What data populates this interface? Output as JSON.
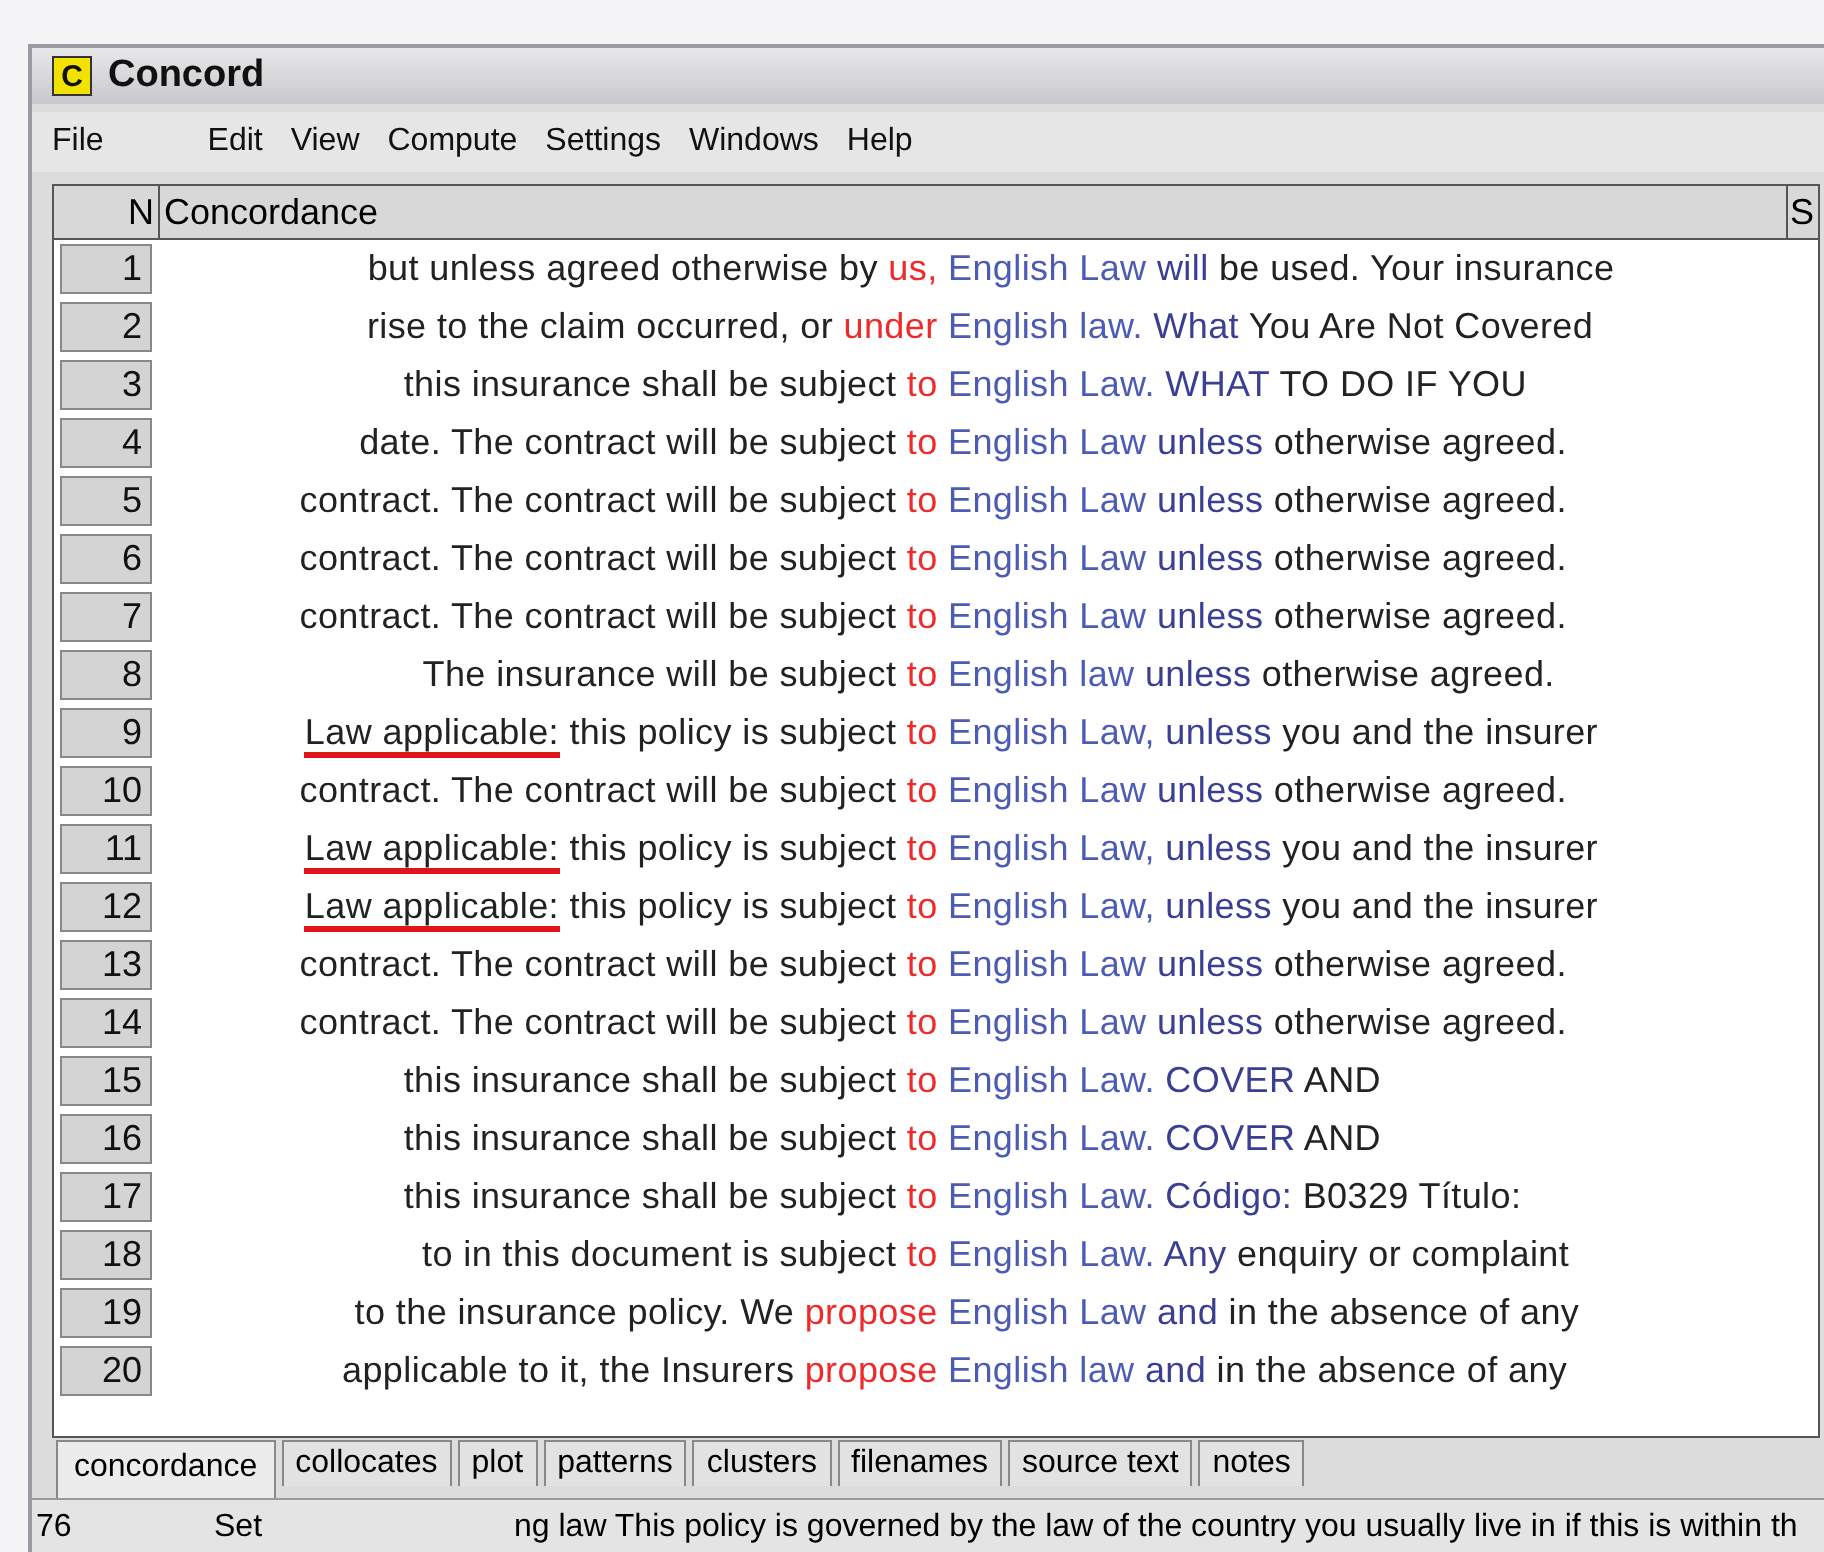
{
  "window": {
    "title": "Concord",
    "logo": "C"
  },
  "menu": [
    "File",
    "Edit",
    "View",
    "Compute",
    "Settings",
    "Windows",
    "Help"
  ],
  "table": {
    "columns": [
      "N",
      "Concordance",
      "S"
    ],
    "rows": [
      {
        "n": "1",
        "left": "but unless agreed otherwise by",
        "collocate": "us,",
        "node": "English Law",
        "right_collocate": "will",
        "right": "be used. Your insurance"
      },
      {
        "n": "2",
        "left": "rise to the claim occurred, or",
        "collocate": "under",
        "node": "English law.",
        "right_collocate": "What",
        "right": "You Are Not Covered"
      },
      {
        "n": "3",
        "left": "this insurance shall be subject",
        "collocate": "to",
        "node": "English Law.",
        "right_collocate": "WHAT",
        "right": "TO DO IF YOU"
      },
      {
        "n": "4",
        "left": "date. The contract will be subject",
        "collocate": "to",
        "node": "English Law",
        "right_collocate": "unless",
        "right": "otherwise agreed."
      },
      {
        "n": "5",
        "left": "contract. The contract will be subject",
        "collocate": "to",
        "node": "English Law",
        "right_collocate": "unless",
        "right": "otherwise agreed."
      },
      {
        "n": "6",
        "left": "contract. The contract will be subject",
        "collocate": "to",
        "node": "English Law",
        "right_collocate": "unless",
        "right": "otherwise agreed."
      },
      {
        "n": "7",
        "left": "contract. The contract will be subject",
        "collocate": "to",
        "node": "English Law",
        "right_collocate": "unless",
        "right": "otherwise agreed."
      },
      {
        "n": "8",
        "left": "The insurance will be subject",
        "collocate": "to",
        "node": "English law",
        "right_collocate": "unless",
        "right": "otherwise agreed."
      },
      {
        "n": "9",
        "marked": "Law applicable:",
        "left": "this policy is subject",
        "collocate": "to",
        "node": "English Law,",
        "right_collocate": "unless",
        "right": "you and the insurer"
      },
      {
        "n": "10",
        "left": "contract. The contract will be subject",
        "collocate": "to",
        "node": "English Law",
        "right_collocate": "unless",
        "right": "otherwise agreed."
      },
      {
        "n": "11",
        "marked": "Law applicable:",
        "left": "this policy is subject",
        "collocate": "to",
        "node": "English Law,",
        "right_collocate": "unless",
        "right": "you and the insurer"
      },
      {
        "n": "12",
        "marked": "Law applicable:",
        "left": "this policy is subject",
        "collocate": "to",
        "node": "English Law,",
        "right_collocate": "unless",
        "right": "you and the insurer"
      },
      {
        "n": "13",
        "left": "contract. The contract will be subject",
        "collocate": "to",
        "node": "English Law",
        "right_collocate": "unless",
        "right": "otherwise agreed."
      },
      {
        "n": "14",
        "left": "contract. The contract will be subject",
        "collocate": "to",
        "node": "English Law",
        "right_collocate": "unless",
        "right": "otherwise agreed."
      },
      {
        "n": "15",
        "left": "this insurance shall be subject",
        "collocate": "to",
        "node": "English Law.",
        "right_collocate": "COVER",
        "right": "AND"
      },
      {
        "n": "16",
        "left": "this insurance shall be subject",
        "collocate": "to",
        "node": "English Law.",
        "right_collocate": "COVER",
        "right": "AND"
      },
      {
        "n": "17",
        "left": "this insurance shall be subject",
        "collocate": "to",
        "node": "English Law.",
        "right_collocate": "Código:",
        "right": "B0329 Título:"
      },
      {
        "n": "18",
        "left": "to in this document is subject",
        "collocate": "to",
        "node": "English Law.",
        "right_collocate": "Any",
        "right": "enquiry or complaint"
      },
      {
        "n": "19",
        "left": "to the insurance policy. We",
        "collocate": "propose",
        "node": "English Law",
        "right_collocate": "and",
        "right": "in the absence of any"
      },
      {
        "n": "20",
        "left": "applicable to it, the Insurers",
        "collocate": "propose",
        "node": "English law",
        "right_collocate": "and",
        "right": "in the absence of any"
      }
    ]
  },
  "tabs": [
    {
      "label": "concordance",
      "selected": true
    },
    {
      "label": "collocates",
      "selected": false
    },
    {
      "label": "plot",
      "selected": false
    },
    {
      "label": "patterns",
      "selected": false
    },
    {
      "label": "clusters",
      "selected": false
    },
    {
      "label": "filenames",
      "selected": false
    },
    {
      "label": "source text",
      "selected": false
    },
    {
      "label": "notes",
      "selected": false
    }
  ],
  "status_bar": {
    "count": "76",
    "mode": "Set",
    "text": "ng law This policy is governed by the law of the country you usually live in if this is within th"
  }
}
